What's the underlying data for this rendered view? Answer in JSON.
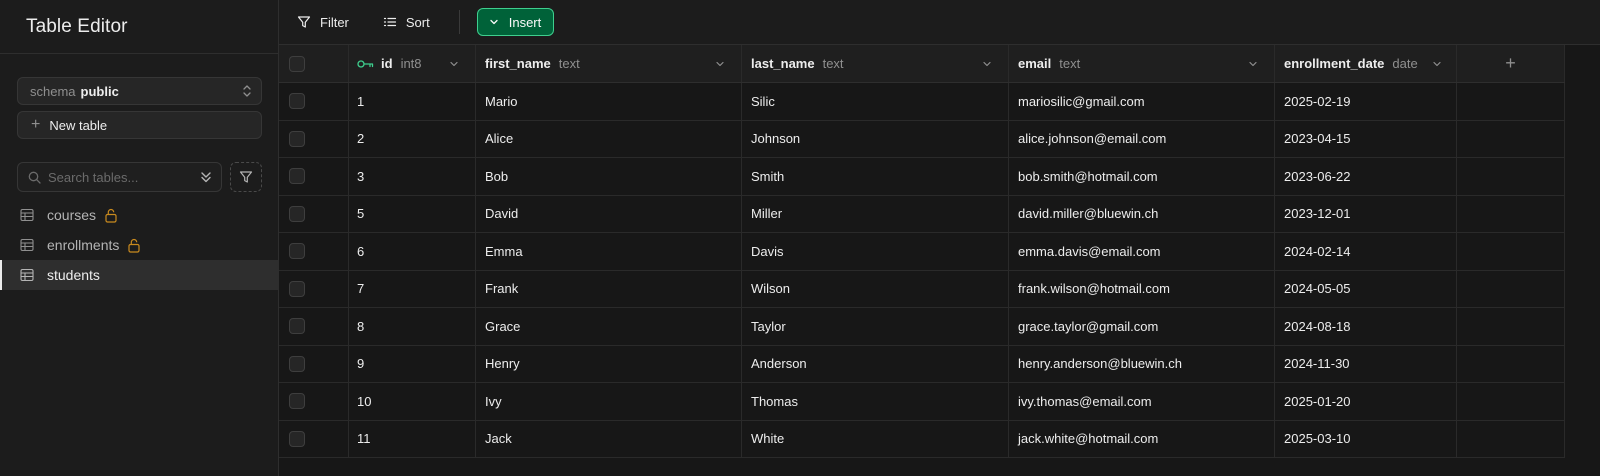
{
  "sidebar": {
    "title": "Table Editor",
    "schema_label": "schema",
    "schema_value": "public",
    "new_table_label": "New table",
    "search_placeholder": "Search tables...",
    "tables": [
      {
        "name": "courses",
        "locked": true,
        "active": false
      },
      {
        "name": "enrollments",
        "locked": true,
        "active": false
      },
      {
        "name": "students",
        "locked": false,
        "active": true
      }
    ]
  },
  "toolbar": {
    "filter_label": "Filter",
    "sort_label": "Sort",
    "insert_label": "Insert"
  },
  "grid": {
    "columns": [
      {
        "name": "id",
        "type": "int8"
      },
      {
        "name": "first_name",
        "type": "text"
      },
      {
        "name": "last_name",
        "type": "text"
      },
      {
        "name": "email",
        "type": "text"
      },
      {
        "name": "enrollment_date",
        "type": "date"
      }
    ],
    "add_column_label": "+",
    "rows": [
      {
        "id": "1",
        "first_name": "Mario",
        "last_name": "Silic",
        "email": "mariosilic@gmail.com",
        "enrollment_date": "2025-02-19"
      },
      {
        "id": "2",
        "first_name": "Alice",
        "last_name": "Johnson",
        "email": "alice.johnson@email.com",
        "enrollment_date": "2023-04-15"
      },
      {
        "id": "3",
        "first_name": "Bob",
        "last_name": "Smith",
        "email": "bob.smith@hotmail.com",
        "enrollment_date": "2023-06-22"
      },
      {
        "id": "5",
        "first_name": "David",
        "last_name": "Miller",
        "email": "david.miller@bluewin.ch",
        "enrollment_date": "2023-12-01"
      },
      {
        "id": "6",
        "first_name": "Emma",
        "last_name": "Davis",
        "email": "emma.davis@email.com",
        "enrollment_date": "2024-02-14"
      },
      {
        "id": "7",
        "first_name": "Frank",
        "last_name": "Wilson",
        "email": "frank.wilson@hotmail.com",
        "enrollment_date": "2024-05-05"
      },
      {
        "id": "8",
        "first_name": "Grace",
        "last_name": "Taylor",
        "email": "grace.taylor@gmail.com",
        "enrollment_date": "2024-08-18"
      },
      {
        "id": "9",
        "first_name": "Henry",
        "last_name": "Anderson",
        "email": "henry.anderson@bluewin.ch",
        "enrollment_date": "2024-11-30"
      },
      {
        "id": "10",
        "first_name": "Ivy",
        "last_name": "Thomas",
        "email": "ivy.thomas@email.com",
        "enrollment_date": "2025-01-20"
      },
      {
        "id": "11",
        "first_name": "Jack",
        "last_name": "White",
        "email": "jack.white@hotmail.com",
        "enrollment_date": "2025-03-10"
      }
    ]
  },
  "colors": {
    "background": "#1c1c1c",
    "grid_background": "#171717",
    "accent_green": "#3ecf8e",
    "insert_button_bg": "#006239",
    "lock_icon": "#c98a1e"
  },
  "icons": {
    "filter": "filter-icon",
    "sort": "sort-icon",
    "insert_chevron": "chevron-down-icon",
    "primary_key": "key-icon",
    "table": "table-icon",
    "lock": "lock-icon",
    "search": "search-icon"
  }
}
